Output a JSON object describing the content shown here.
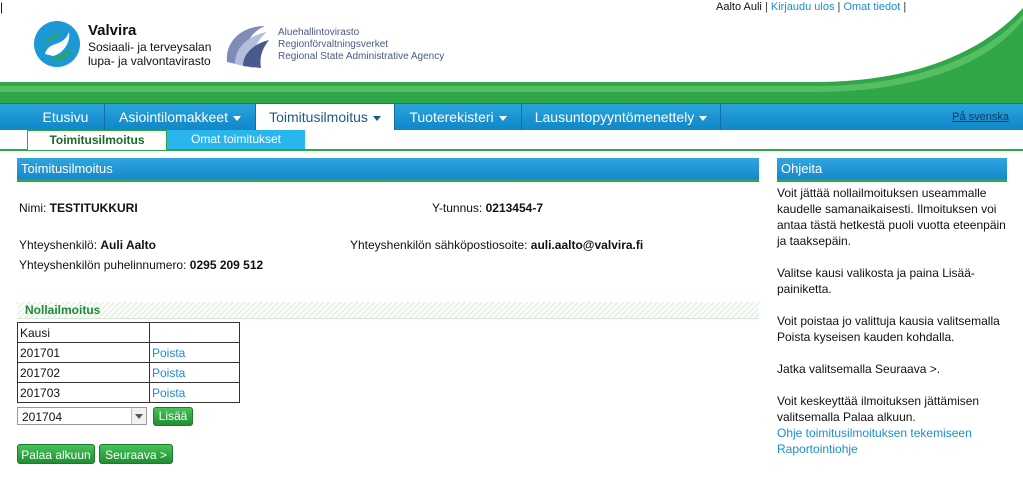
{
  "user": {
    "name": "Aalto Auli",
    "logout": "Kirjaudu ulos",
    "my_info": "Omat tiedot"
  },
  "logos": {
    "valvira_name": "Valvira",
    "valvira_line1": "Sosiaali- ja terveysalan",
    "valvira_line2": "lupa- ja valvontavirasto",
    "avi_line1": "Aluehallintovirasto",
    "avi_line2": "Regionförvaltningsverket",
    "avi_line3": "Regional State Administrative Agency"
  },
  "nav": {
    "items": [
      "Etusivu",
      "Asiointilomakkeet",
      "Toimitusilmoitus",
      "Tuoterekisteri",
      "Lausuntopyyntömenettely"
    ],
    "lang": "På svenska"
  },
  "subnav": {
    "items": [
      "Toimitusilmoitus",
      "Omat toimitukset"
    ]
  },
  "main": {
    "title": "Toimitusilmoitus",
    "name_label": "Nimi:",
    "name_value": "TESTITUKKURI",
    "ytunnus_label": "Y-tunnus:",
    "ytunnus_value": "0213454-7",
    "contact_label": "Yhteyshenkilö:",
    "contact_value": "Auli Aalto",
    "email_label": "Yhteyshenkilön sähköpostiosoite:",
    "email_value": "auli.aalto@valvira.fi",
    "phone_label": "Yhteyshenkilön puhelinnumero:",
    "phone_value": "0295 209 512",
    "section_title": "Nollailmoitus",
    "table": {
      "header": "Kausi",
      "rows": [
        {
          "kausi": "201701",
          "action": "Poista"
        },
        {
          "kausi": "201702",
          "action": "Poista"
        },
        {
          "kausi": "201703",
          "action": "Poista"
        }
      ]
    },
    "select_value": "201704",
    "add_button": "Lisää",
    "back_button": "Palaa alkuun",
    "next_button": "Seuraava >"
  },
  "help": {
    "title": "Ohjeita",
    "paragraphs": [
      "Voit jättää nollailmoituksen useammalle kaudelle samanaikaisesti. Ilmoituksen voi antaa tästä hetkestä puoli vuotta eteenpäin ja taaksepäin.",
      "Valitse kausi valikosta ja paina Lisää-painiketta.",
      "Voit poistaa jo valittuja kausia valitsemalla Poista kyseisen kauden kohdalla.",
      "Jatka valitsemalla Seuraava >.",
      "Voit keskeyttää ilmoituksen jättämisen valitsemalla Palaa alkuun."
    ],
    "links": [
      "Ohje toimitusilmoituksen tekemiseen",
      "Raportointiohje"
    ]
  },
  "colors": {
    "nav_blue": "#1788cb",
    "accent_green": "#2fa648",
    "link_blue": "#1a8fd0"
  }
}
